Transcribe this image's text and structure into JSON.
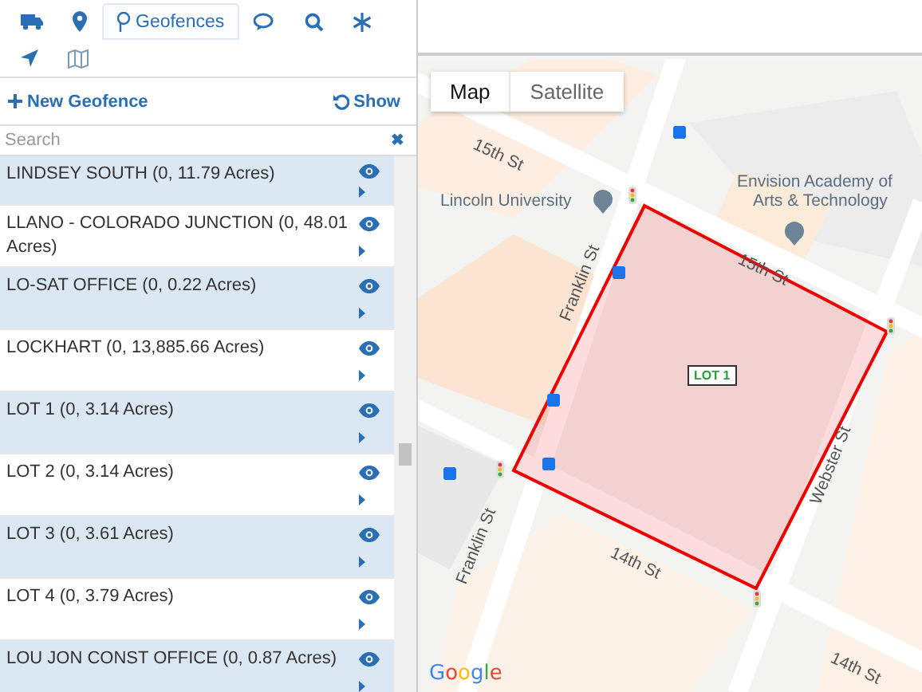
{
  "tabs": [
    {
      "selected": false
    },
    {
      "selected": false
    },
    {
      "label": "Geofences",
      "selected": true
    },
    {
      "selected": false
    },
    {
      "selected": false
    },
    {
      "selected": false
    },
    {
      "selected": false
    },
    {
      "selected": false
    }
  ],
  "toolbar": {
    "new_button": "New Geofence",
    "show_button": "Show"
  },
  "search": {
    "placeholder": "Search",
    "clear": "✖"
  },
  "geofences": [
    {
      "name": "LINDSEY SOUTH (0, 11.79 Acres)"
    },
    {
      "name": "LLANO - COLORADO JUNCTION (0, 48.01 Acres)"
    },
    {
      "name": "LO-SAT OFFICE (0, 0.22 Acres)"
    },
    {
      "name": "LOCKHART (0, 13,885.66 Acres)"
    },
    {
      "name": "LOT 1 (0, 3.14 Acres)"
    },
    {
      "name": "LOT 2 (0, 3.14 Acres)"
    },
    {
      "name": "LOT 3 (0, 3.61 Acres)"
    },
    {
      "name": "LOT 4 (0, 3.79 Acres)"
    },
    {
      "name": "LOU JON CONST OFFICE (0, 0.87 Acres)"
    }
  ],
  "map": {
    "types": [
      {
        "label": "Map",
        "selected": true
      },
      {
        "label": "Satellite",
        "selected": false
      }
    ],
    "labels": [
      "15th St",
      "15th St",
      "14th St",
      "14th St",
      "Franklin St",
      "Franklin St",
      "Webster St"
    ],
    "places": [
      "Lincoln University",
      "Envision Academy of",
      "Arts & Technology"
    ],
    "fence_label": "LOT 1",
    "attribution": "Google"
  }
}
